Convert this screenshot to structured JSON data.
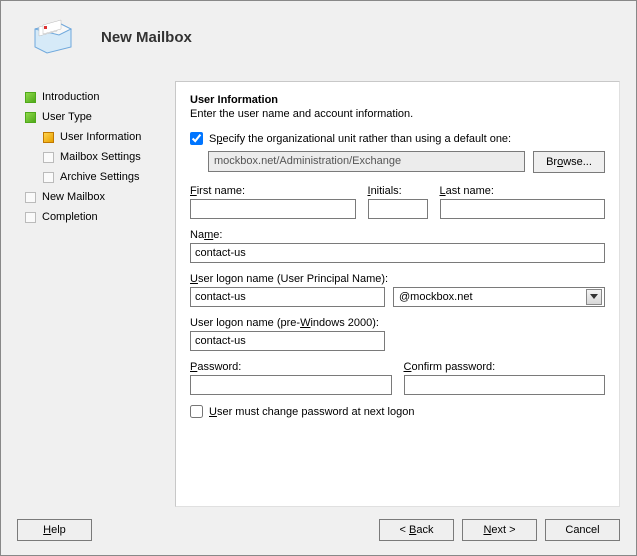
{
  "header": {
    "title": "New Mailbox"
  },
  "nav": {
    "introduction": "Introduction",
    "user_type": "User Type",
    "user_information": "User Information",
    "mailbox_settings": "Mailbox Settings",
    "archive_settings": "Archive Settings",
    "new_mailbox": "New Mailbox",
    "completion": "Completion"
  },
  "content": {
    "section_title": "User Information",
    "section_sub": "Enter the user name and account information.",
    "specify_ou_pre": "S",
    "specify_ou_rest": "ecify the organizational unit rather than using a default one:",
    "ou_value": "mockbox.net/Administration/Exchange",
    "browse_label": "Browse...",
    "first_name_pre": "F",
    "first_name_rest": "irst name:",
    "initials_pre": "I",
    "initials_rest": "nitials:",
    "last_name_pre": "L",
    "last_name_rest": "ast name:",
    "name_pre": "N",
    "name_rest": "ame:",
    "name_value": "contact-us",
    "upn_pre": "U",
    "upn_rest": "ser logon name (User Principal Name):",
    "upn_value": "contact-us",
    "upn_domain": "@mockbox.net",
    "pre2000_label_pre": "User logon name (pre-",
    "pre2000_label_u": "W",
    "pre2000_label_rest": "indows 2000):",
    "pre2000_value": "contact-us",
    "password_pre": "P",
    "password_rest": "assword:",
    "confirm_pre": "C",
    "confirm_rest": "onfirm password:",
    "must_change_pre": "U",
    "must_change_rest": "ser must change password at next logon"
  },
  "footer": {
    "help": "Help",
    "back_pre": "< ",
    "back_u": "B",
    "back_rest": "ack",
    "next_pre": "",
    "next_u": "N",
    "next_rest": "ext >",
    "cancel": "Cancel"
  }
}
